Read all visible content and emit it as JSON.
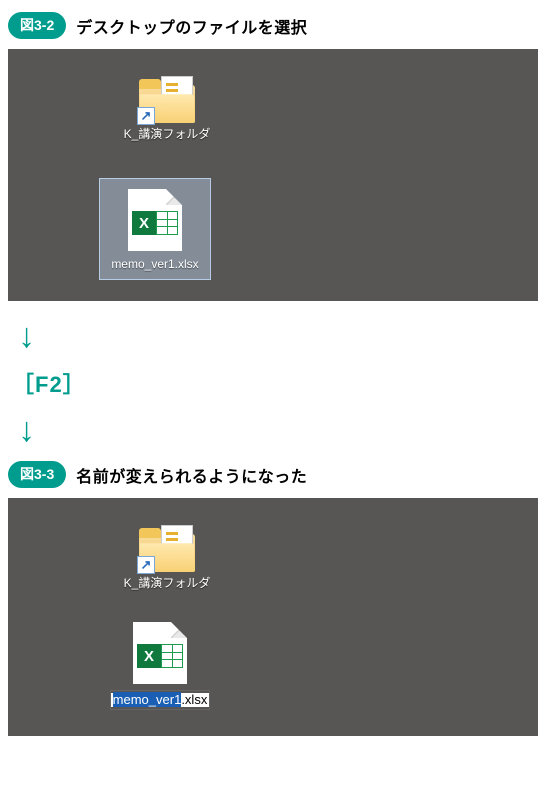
{
  "figures": {
    "a": {
      "pill": "図3-2",
      "caption": "デスクトップのファイルを選択"
    },
    "b": {
      "pill": "図3-3",
      "caption": "名前が変えられるようになった"
    }
  },
  "desktop": {
    "folderName": "K_講演フォルダ",
    "fileName": "memo_ver1.xlsx",
    "rename": {
      "selected": "memo_ver1",
      "rest": ".xlsx"
    }
  },
  "flow": {
    "arrow1": "↓",
    "key": {
      "open": "［",
      "label": "F2",
      "close": "］"
    },
    "arrow2": "↓"
  },
  "glyphs": {
    "x": "X",
    "shortcutArrow": "↗"
  }
}
